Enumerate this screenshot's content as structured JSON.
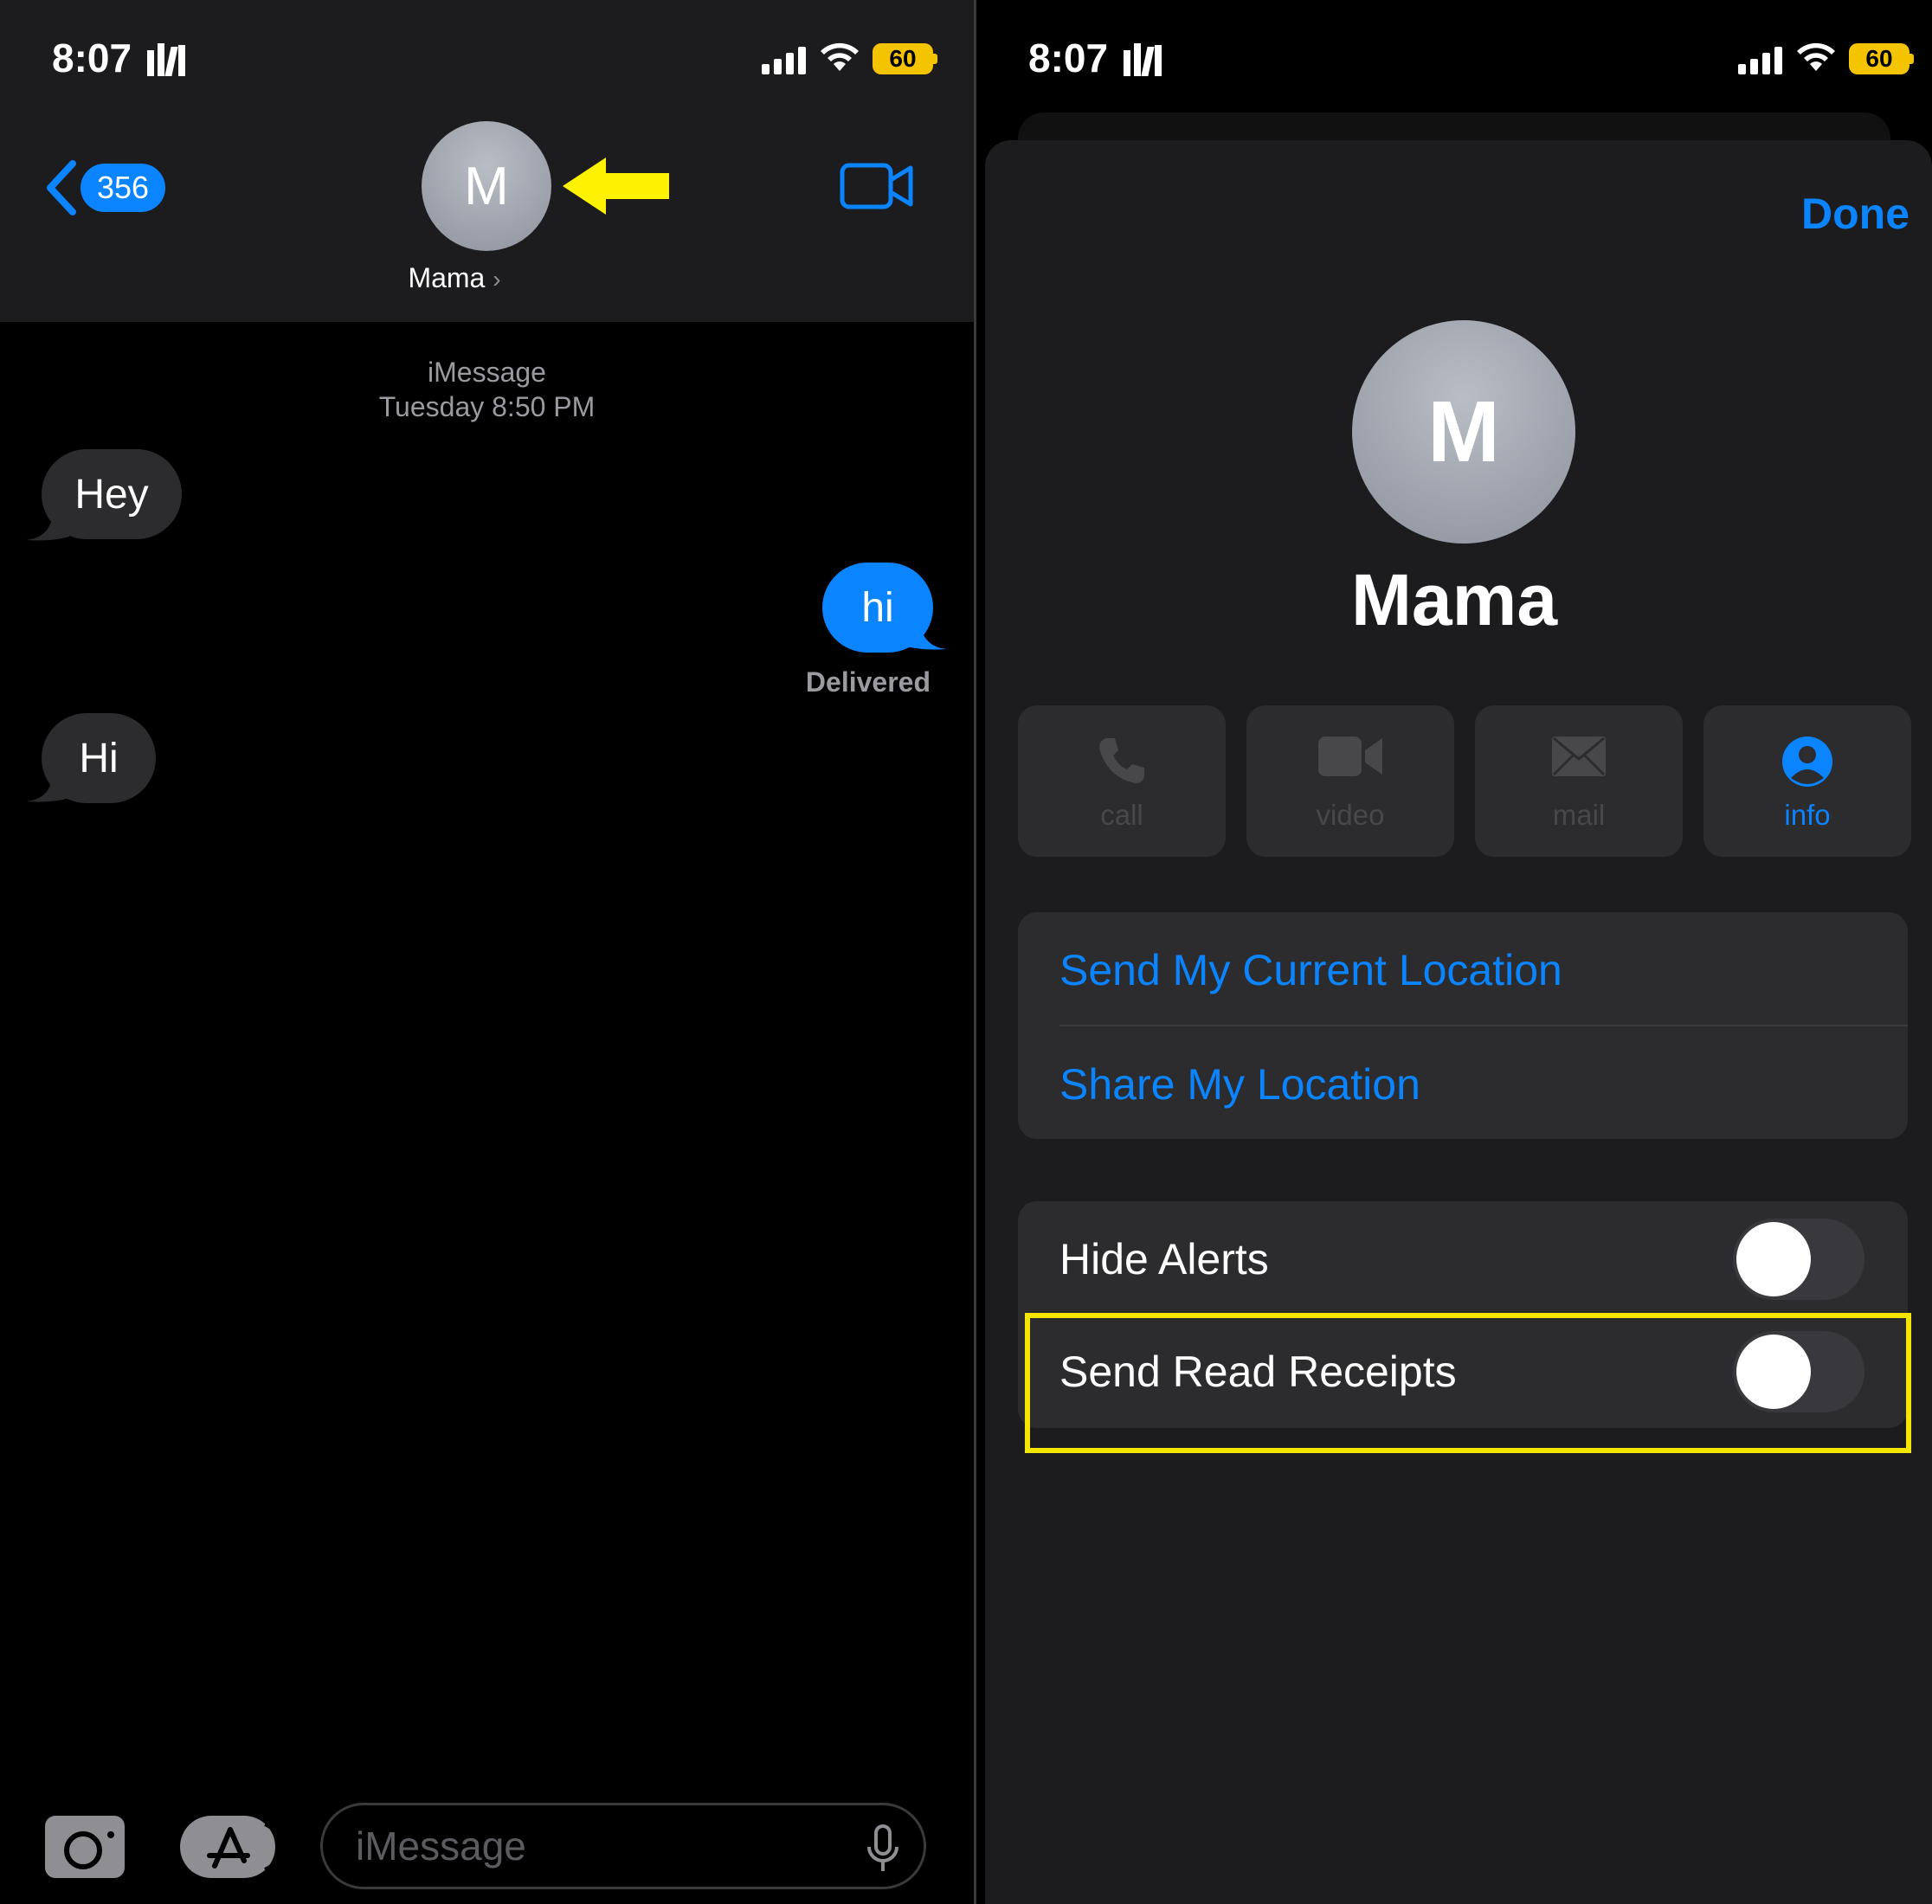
{
  "status_bar": {
    "time": "8:07",
    "battery": "60"
  },
  "left": {
    "back_count": "356",
    "contact_initial": "M",
    "contact_name": "Mama",
    "service": "iMessage",
    "timestamp": "Tuesday 8:50 PM",
    "messages": [
      {
        "text": "Hey",
        "direction": "incoming"
      },
      {
        "text": "hi",
        "direction": "outgoing"
      },
      {
        "text": "Hi",
        "direction": "incoming"
      }
    ],
    "delivered": "Delivered",
    "input_placeholder": "iMessage"
  },
  "right": {
    "done_label": "Done",
    "contact_initial": "M",
    "contact_name": "Mama",
    "actions": [
      {
        "label": "call",
        "icon": "phone-icon",
        "enabled": false
      },
      {
        "label": "video",
        "icon": "video-camera-icon",
        "enabled": false
      },
      {
        "label": "mail",
        "icon": "envelope-icon",
        "enabled": false
      },
      {
        "label": "info",
        "icon": "person-circle-icon",
        "enabled": true
      }
    ],
    "location": {
      "send_current": "Send My Current Location",
      "share": "Share My Location"
    },
    "settings": {
      "hide_alerts": {
        "label": "Hide Alerts",
        "on": false
      },
      "send_read_receipts": {
        "label": "Send Read Receipts",
        "on": false
      }
    }
  },
  "colors": {
    "accent": "#0a84ff",
    "highlight": "#f5e600",
    "annotation_arrow": "#fff200"
  }
}
